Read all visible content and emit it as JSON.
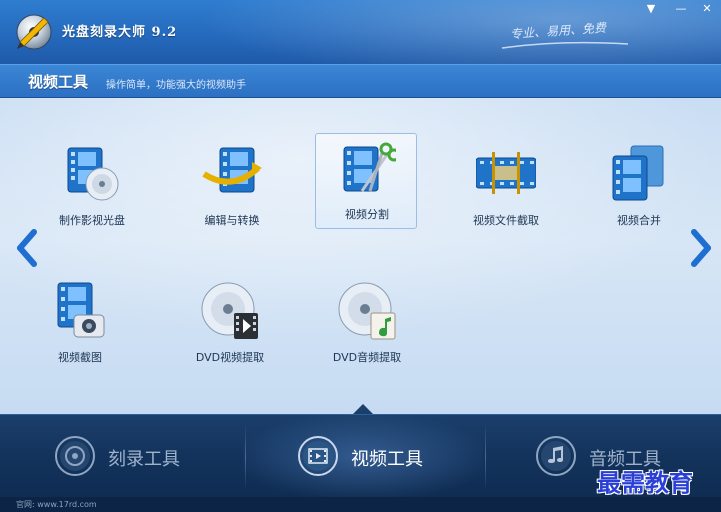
{
  "app": {
    "title": "光盘刻录大师 9.2",
    "slogan": "专业、易用、免费",
    "window_buttons": [
      "▼",
      "—",
      "✕"
    ]
  },
  "section": {
    "title": "视频工具",
    "subtitle": "操作简单，功能强大的视频助手"
  },
  "tools": [
    {
      "label": "制作影视光盘",
      "icon": "film-disc-icon"
    },
    {
      "label": "编辑与转换",
      "icon": "film-convert-icon"
    },
    {
      "label": "视频分割",
      "icon": "film-scissors-icon",
      "selected": true
    },
    {
      "label": "视频文件截取",
      "icon": "film-clip-icon"
    },
    {
      "label": "视频合并",
      "icon": "film-merge-icon"
    },
    {
      "label": "视频截图",
      "icon": "film-camera-icon"
    },
    {
      "label": "DVD视频提取",
      "icon": "dvd-video-icon"
    },
    {
      "label": "DVD音频提取",
      "icon": "dvd-audio-icon"
    }
  ],
  "bottom_tabs": [
    {
      "label": "刻录工具",
      "icon": "disc-icon"
    },
    {
      "label": "视频工具",
      "icon": "film-icon",
      "active": true
    },
    {
      "label": "音频工具",
      "icon": "music-note-icon"
    }
  ],
  "status": {
    "url": "官网: www.17rd.com"
  },
  "watermark": "最需教育",
  "colors": {
    "title_bar": "#2468bb",
    "content_bg": "#d7e6f6",
    "bottom_bar": "#13335c",
    "accent_arrow": "#1f6fd0",
    "watermark": "#2a3fd6"
  }
}
